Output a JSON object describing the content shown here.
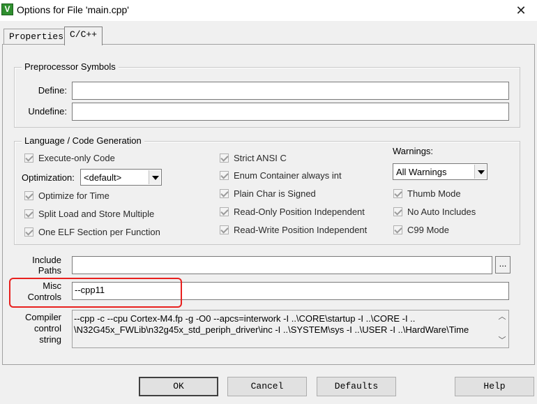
{
  "window": {
    "title": "Options for File 'main.cpp'",
    "icon": "keil-uvision-icon",
    "close_glyph": "✕"
  },
  "tabs": [
    {
      "label": "Properties",
      "active": false
    },
    {
      "label": "C/C++",
      "active": true
    }
  ],
  "preprocessor": {
    "title": "Preprocessor Symbols",
    "define_label": "Define:",
    "define_value": "",
    "undefine_label": "Undefine:",
    "undefine_value": ""
  },
  "language": {
    "title": "Language / Code Generation",
    "col1": [
      {
        "label": "Execute-only Code",
        "checked": true
      },
      {
        "label": "Optimize for Time",
        "checked": true
      },
      {
        "label": "Split Load and Store Multiple",
        "checked": true
      },
      {
        "label": "One ELF Section per Function",
        "checked": true
      }
    ],
    "optimization_label": "Optimization:",
    "optimization_value": "<default>",
    "col2": [
      {
        "label": "Strict ANSI C",
        "checked": true
      },
      {
        "label": "Enum Container always int",
        "checked": true
      },
      {
        "label": "Plain Char is Signed",
        "checked": true
      },
      {
        "label": "Read-Only Position Independent",
        "checked": true
      },
      {
        "label": "Read-Write Position Independent",
        "checked": true
      }
    ],
    "warnings_label": "Warnings:",
    "warnings_value": "All Warnings",
    "col3": [
      {
        "label": "Thumb Mode",
        "checked": true
      },
      {
        "label": "No Auto Includes",
        "checked": true
      },
      {
        "label": "C99 Mode",
        "checked": true
      }
    ]
  },
  "include_paths": {
    "label_line1": "Include",
    "label_line2": "Paths",
    "value": "",
    "browse_label": "..."
  },
  "misc_controls": {
    "label_line1": "Misc",
    "label_line2": "Controls",
    "value": "--cpp11"
  },
  "compiler_control": {
    "label_line1": "Compiler",
    "label_line2": "control",
    "label_line3": "string",
    "line1": "--cpp -c --cpu Cortex-M4.fp -g -O0 --apcs=interwork -I ..\\CORE\\startup -I ..\\CORE -I ..",
    "line2": "\\N32G45x_FWLib\\n32g45x_std_periph_driver\\inc -I ..\\SYSTEM\\sys -I ..\\USER -I ..\\HardWare\\Time"
  },
  "buttons": {
    "ok": "OK",
    "cancel": "Cancel",
    "defaults": "Defaults",
    "help": "Help"
  },
  "colors": {
    "highlight": "#e8201e",
    "dialog_bg": "#f0f0f0"
  }
}
